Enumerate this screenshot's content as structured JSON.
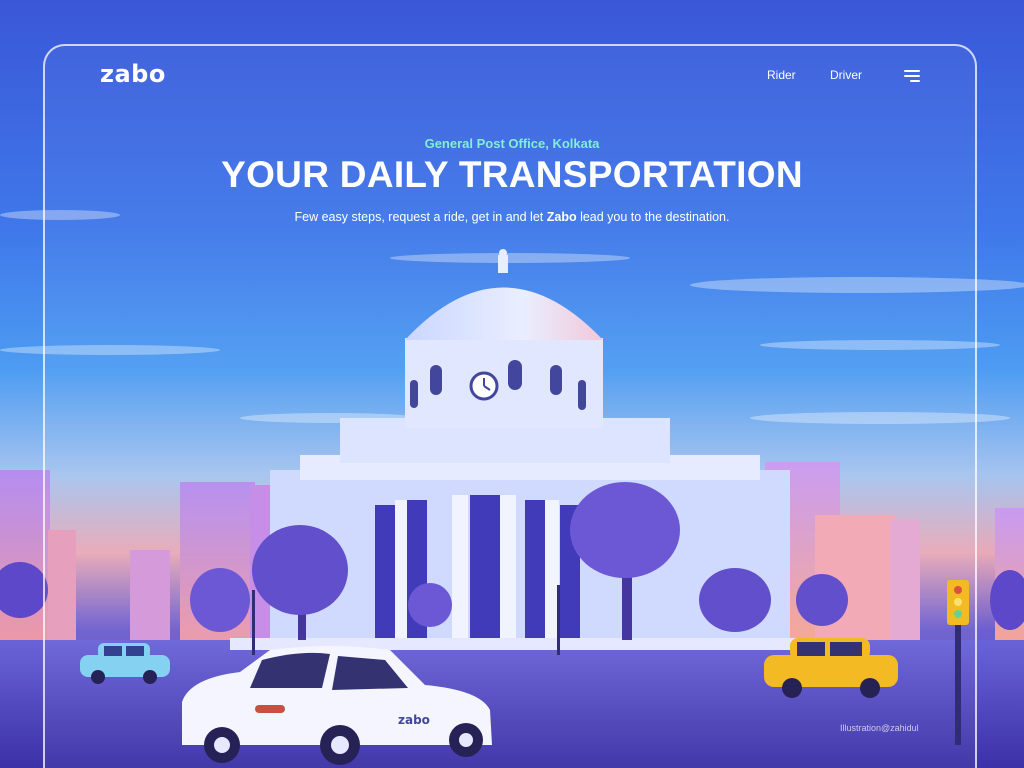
{
  "header": {
    "logo": "zabo",
    "nav": [
      {
        "label": "Rider"
      },
      {
        "label": "Driver"
      }
    ],
    "menu_icon": "hamburger-menu-icon"
  },
  "hero": {
    "location": "General Post Office, Kolkata",
    "title": "YOUR DAILY TRANSPORTATION",
    "description_before": "Few easy steps, request a ride, get in and let ",
    "description_brand": "Zabo",
    "description_after": " lead you to the destination."
  },
  "illustration": {
    "car_label": "zabo",
    "credit": "Illustration@zahidul"
  },
  "colors": {
    "accent": "#7ff0d4",
    "sky_top": "#3a57d8",
    "sky_mid": "#4d9cf2",
    "ground": "#4b3fb6",
    "building": "#dfe6ff",
    "taxi_yellow": "#f4b81c"
  }
}
